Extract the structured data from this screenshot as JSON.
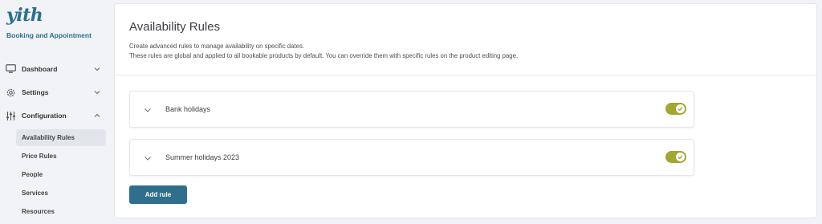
{
  "brand": {
    "logo": "yith",
    "plugin_name": "Booking and Appointment",
    "color": "#2c6e8e"
  },
  "sidebar": {
    "items": [
      {
        "label": "Dashboard",
        "icon": "monitor-icon",
        "chevron": "down"
      },
      {
        "label": "Settings",
        "icon": "gear-icon",
        "chevron": "down"
      },
      {
        "label": "Configuration",
        "icon": "sliders-icon",
        "chevron": "up"
      }
    ],
    "sub_items": [
      {
        "label": "Availability Rules",
        "active": true
      },
      {
        "label": "Price Rules",
        "active": false
      },
      {
        "label": "People",
        "active": false
      },
      {
        "label": "Services",
        "active": false
      },
      {
        "label": "Resources",
        "active": false
      }
    ]
  },
  "main": {
    "title": "Availability Rules",
    "description_line1": "Create advanced rules to manage availability on specific dates.",
    "description_line2": "These rules are global and applied to all bookable products by default. You can override them with specific rules on the product editing page.",
    "rules": [
      {
        "name": "Bank holidays",
        "enabled": true
      },
      {
        "name": "Summer holidays 2023",
        "enabled": true
      }
    ],
    "add_button": "Add rule"
  },
  "colors": {
    "accent": "#2f6e8d",
    "toggle_on": "#a3a631",
    "active_bg": "#e2e6ec"
  }
}
